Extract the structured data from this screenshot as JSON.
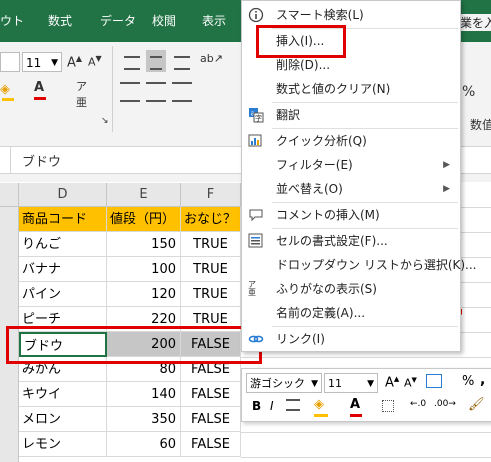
{
  "ribbon_tabs": [
    "ウト",
    "数式",
    "データ",
    "校閲",
    "表示"
  ],
  "ribbon_tab_right": "業を入",
  "font_size": "11",
  "ribbon_right_label": "数值",
  "percent_symbol": "%",
  "formula_bar_value": "ブドウ",
  "columns": [
    "D",
    "E",
    "F"
  ],
  "table": {
    "headers": [
      "商品コード",
      "値段（円）",
      "おなじ？"
    ],
    "rows": [
      [
        "りんご",
        "150",
        "TRUE"
      ],
      [
        "バナナ",
        "100",
        "TRUE"
      ],
      [
        "パイン",
        "120",
        "TRUE"
      ],
      [
        "ピーチ",
        "220",
        "TRUE"
      ],
      [
        "ブドウ",
        "200",
        "FALSE"
      ],
      [
        "みかん",
        "80",
        "FALSE"
      ],
      [
        "キウイ",
        "140",
        "FALSE"
      ],
      [
        "メロン",
        "350",
        "FALSE"
      ],
      [
        "レモン",
        "60",
        "FALSE"
      ]
    ]
  },
  "context_menu": {
    "items": [
      {
        "label": "スマート検索(L)",
        "icon": "info-icon"
      },
      {
        "label": "挿入(I)...",
        "icon": ""
      },
      {
        "label": "削除(D)...",
        "icon": ""
      },
      {
        "label": "数式と値のクリア(N)",
        "icon": ""
      },
      {
        "label": "翻訳",
        "icon": "translate-icon"
      },
      {
        "label": "クイック分析(Q)",
        "icon": "quick-analysis-icon"
      },
      {
        "label": "フィルター(E)",
        "icon": "",
        "submenu": true
      },
      {
        "label": "並べ替え(O)",
        "icon": "",
        "submenu": true
      },
      {
        "label": "コメントの挿入(M)",
        "icon": "comment-icon"
      },
      {
        "label": "セルの書式設定(F)...",
        "icon": "format-cells-icon"
      },
      {
        "label": "ドロップダウン リストから選択(K)...",
        "icon": ""
      },
      {
        "label": "ふりがなの表示(S)",
        "icon": "furigana-icon"
      },
      {
        "label": "名前の定義(A)...",
        "icon": ""
      },
      {
        "label": "リンク(I)",
        "icon": "link-icon"
      }
    ]
  },
  "mini_toolbar": {
    "font_name": "游ゴシック",
    "font_size": "11",
    "bold": "B",
    "italic": "I",
    "percent": "%",
    "comma": ","
  },
  "colors": {
    "ribbon": "#217346",
    "header_fill": "#ffc000",
    "highlight": "#e00000",
    "selection": "#c6c6c6"
  }
}
